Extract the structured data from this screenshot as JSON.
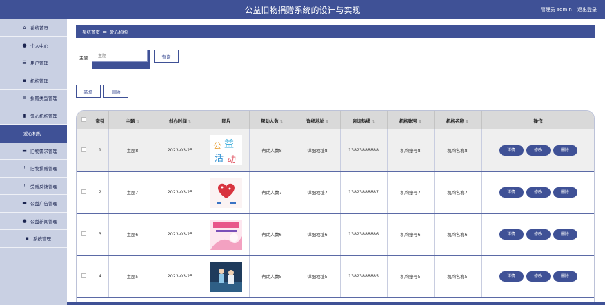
{
  "header": {
    "title": "公益旧物捐赠系统的设计与实现",
    "user": "管理员 admin",
    "logout": "退出登录"
  },
  "sidebar": {
    "items": [
      {
        "label": "系统首页",
        "icon": "home-icon",
        "glyph": "⌂"
      },
      {
        "label": "个人中心",
        "icon": "user-icon",
        "glyph": "●"
      },
      {
        "label": "用户管理",
        "icon": "sliders-icon",
        "glyph": "☰"
      },
      {
        "label": "机构管理",
        "icon": "clipboard-icon",
        "glyph": "▪"
      },
      {
        "label": "捐赠类型管理",
        "icon": "list-icon",
        "glyph": "≡"
      },
      {
        "label": "爱心机构管理",
        "icon": "chart-icon",
        "glyph": "▮"
      },
      {
        "label": "爱心机构",
        "icon": "",
        "glyph": ""
      },
      {
        "label": "旧物需求管理",
        "icon": "card-icon",
        "glyph": "▬"
      },
      {
        "label": "旧物捐赠管理",
        "icon": "grid-icon",
        "glyph": "⁞"
      },
      {
        "label": "受赠反馈管理",
        "icon": "grid-icon",
        "glyph": "⁞"
      },
      {
        "label": "公益广告管理",
        "icon": "card-icon",
        "glyph": "▬"
      },
      {
        "label": "公益新闻管理",
        "icon": "person-icon",
        "glyph": "●"
      },
      {
        "label": "系统管理",
        "icon": "clipboard-icon",
        "glyph": "▪"
      }
    ]
  },
  "breadcrumb": {
    "home": "系统首页",
    "sep": "☰",
    "current": "爱心机构"
  },
  "search": {
    "label": "主题",
    "placeholder": "主题",
    "query_label": "查询"
  },
  "toolbar": {
    "add_label": "新增",
    "delete_label": "删除"
  },
  "table": {
    "headers": [
      "索引",
      "主题",
      "创办时间",
      "图片",
      "帮助人数",
      "详细地址",
      "咨询热线",
      "机构账号",
      "机构名称",
      "操作"
    ],
    "actions": {
      "detail": "详情",
      "edit": "修改",
      "delete": "删除"
    },
    "rows": [
      {
        "index": "1",
        "theme": "主题8",
        "date": "2023-03-25",
        "helped": "帮助人数8",
        "address": "详细地址8",
        "hotline": "13823888888",
        "account": "机构账号8",
        "name": "机构名称8",
        "img": "charity-text-image"
      },
      {
        "index": "2",
        "theme": "主题7",
        "date": "2023-03-25",
        "helped": "帮助人数7",
        "address": "详细地址7",
        "hotline": "13823888887",
        "account": "机构账号7",
        "name": "机构名称7",
        "img": "heart-image"
      },
      {
        "index": "3",
        "theme": "主题6",
        "date": "2023-03-25",
        "helped": "帮助人数6",
        "address": "详细地址6",
        "hotline": "13823888886",
        "account": "机构账号6",
        "name": "机构名称6",
        "img": "poster-image"
      },
      {
        "index": "4",
        "theme": "主题5",
        "date": "2023-03-25",
        "helped": "帮助人数5",
        "address": "详细地址5",
        "hotline": "13823888885",
        "account": "机构账号5",
        "name": "机构名称5",
        "img": "photo-image"
      }
    ]
  },
  "colors": {
    "primary": "#3f5196",
    "sidebar_bg": "#c9d0e3",
    "page_bg": "#9aa5cc"
  }
}
